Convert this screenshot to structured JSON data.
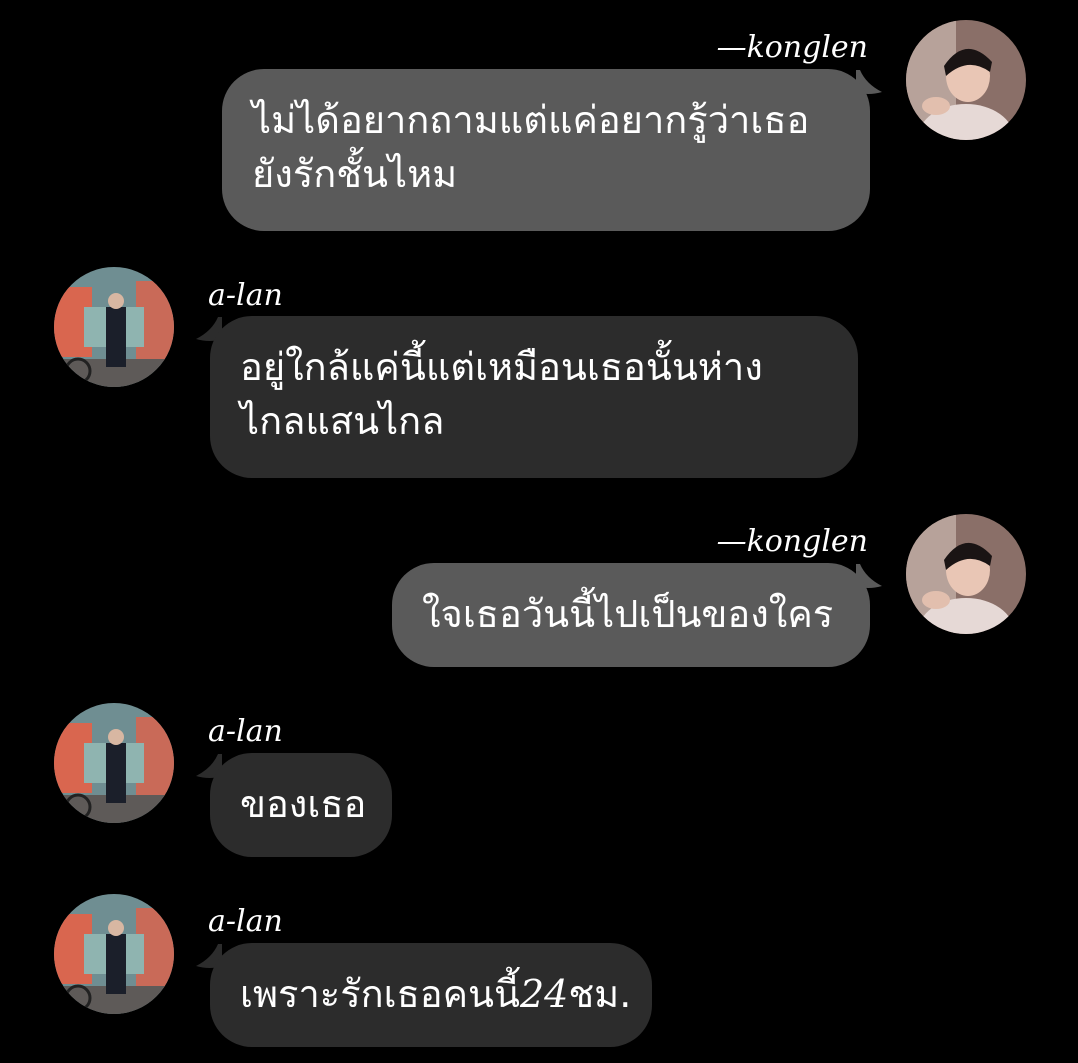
{
  "messages": [
    {
      "sender": "—konglen",
      "side": "outgoing",
      "lines": [
        "ไม่ได้อยากถามแต่แค่อยากรู้ว่าเธอ",
        "ยังรักชั้นไหม"
      ]
    },
    {
      "sender": "a-lan",
      "side": "incoming",
      "lines": [
        "อยู่ใกล้แค่นี้แต่เหมือนเธอนั้นห่าง",
        "ไกลแสนไกล"
      ]
    },
    {
      "sender": "—konglen",
      "side": "outgoing",
      "lines": [
        "ใจเธอวันนี้ไปเป็นของใคร"
      ]
    },
    {
      "sender": "a-lan",
      "side": "incoming",
      "lines": [
        "ของเธอ"
      ]
    },
    {
      "sender": "a-lan",
      "side": "incoming",
      "lines_parts": [
        "เพราะรักเธอคนนี้",
        "24",
        "ชม."
      ]
    }
  ],
  "colors": {
    "background": "#000000",
    "outgoing_bubble": "#5a5a5a",
    "incoming_bubble": "#2c2c2c",
    "text": "#ffffff"
  },
  "icons": {
    "konglen_avatar": "person-avatar-icon",
    "alan_avatar": "person-avatar-icon"
  }
}
